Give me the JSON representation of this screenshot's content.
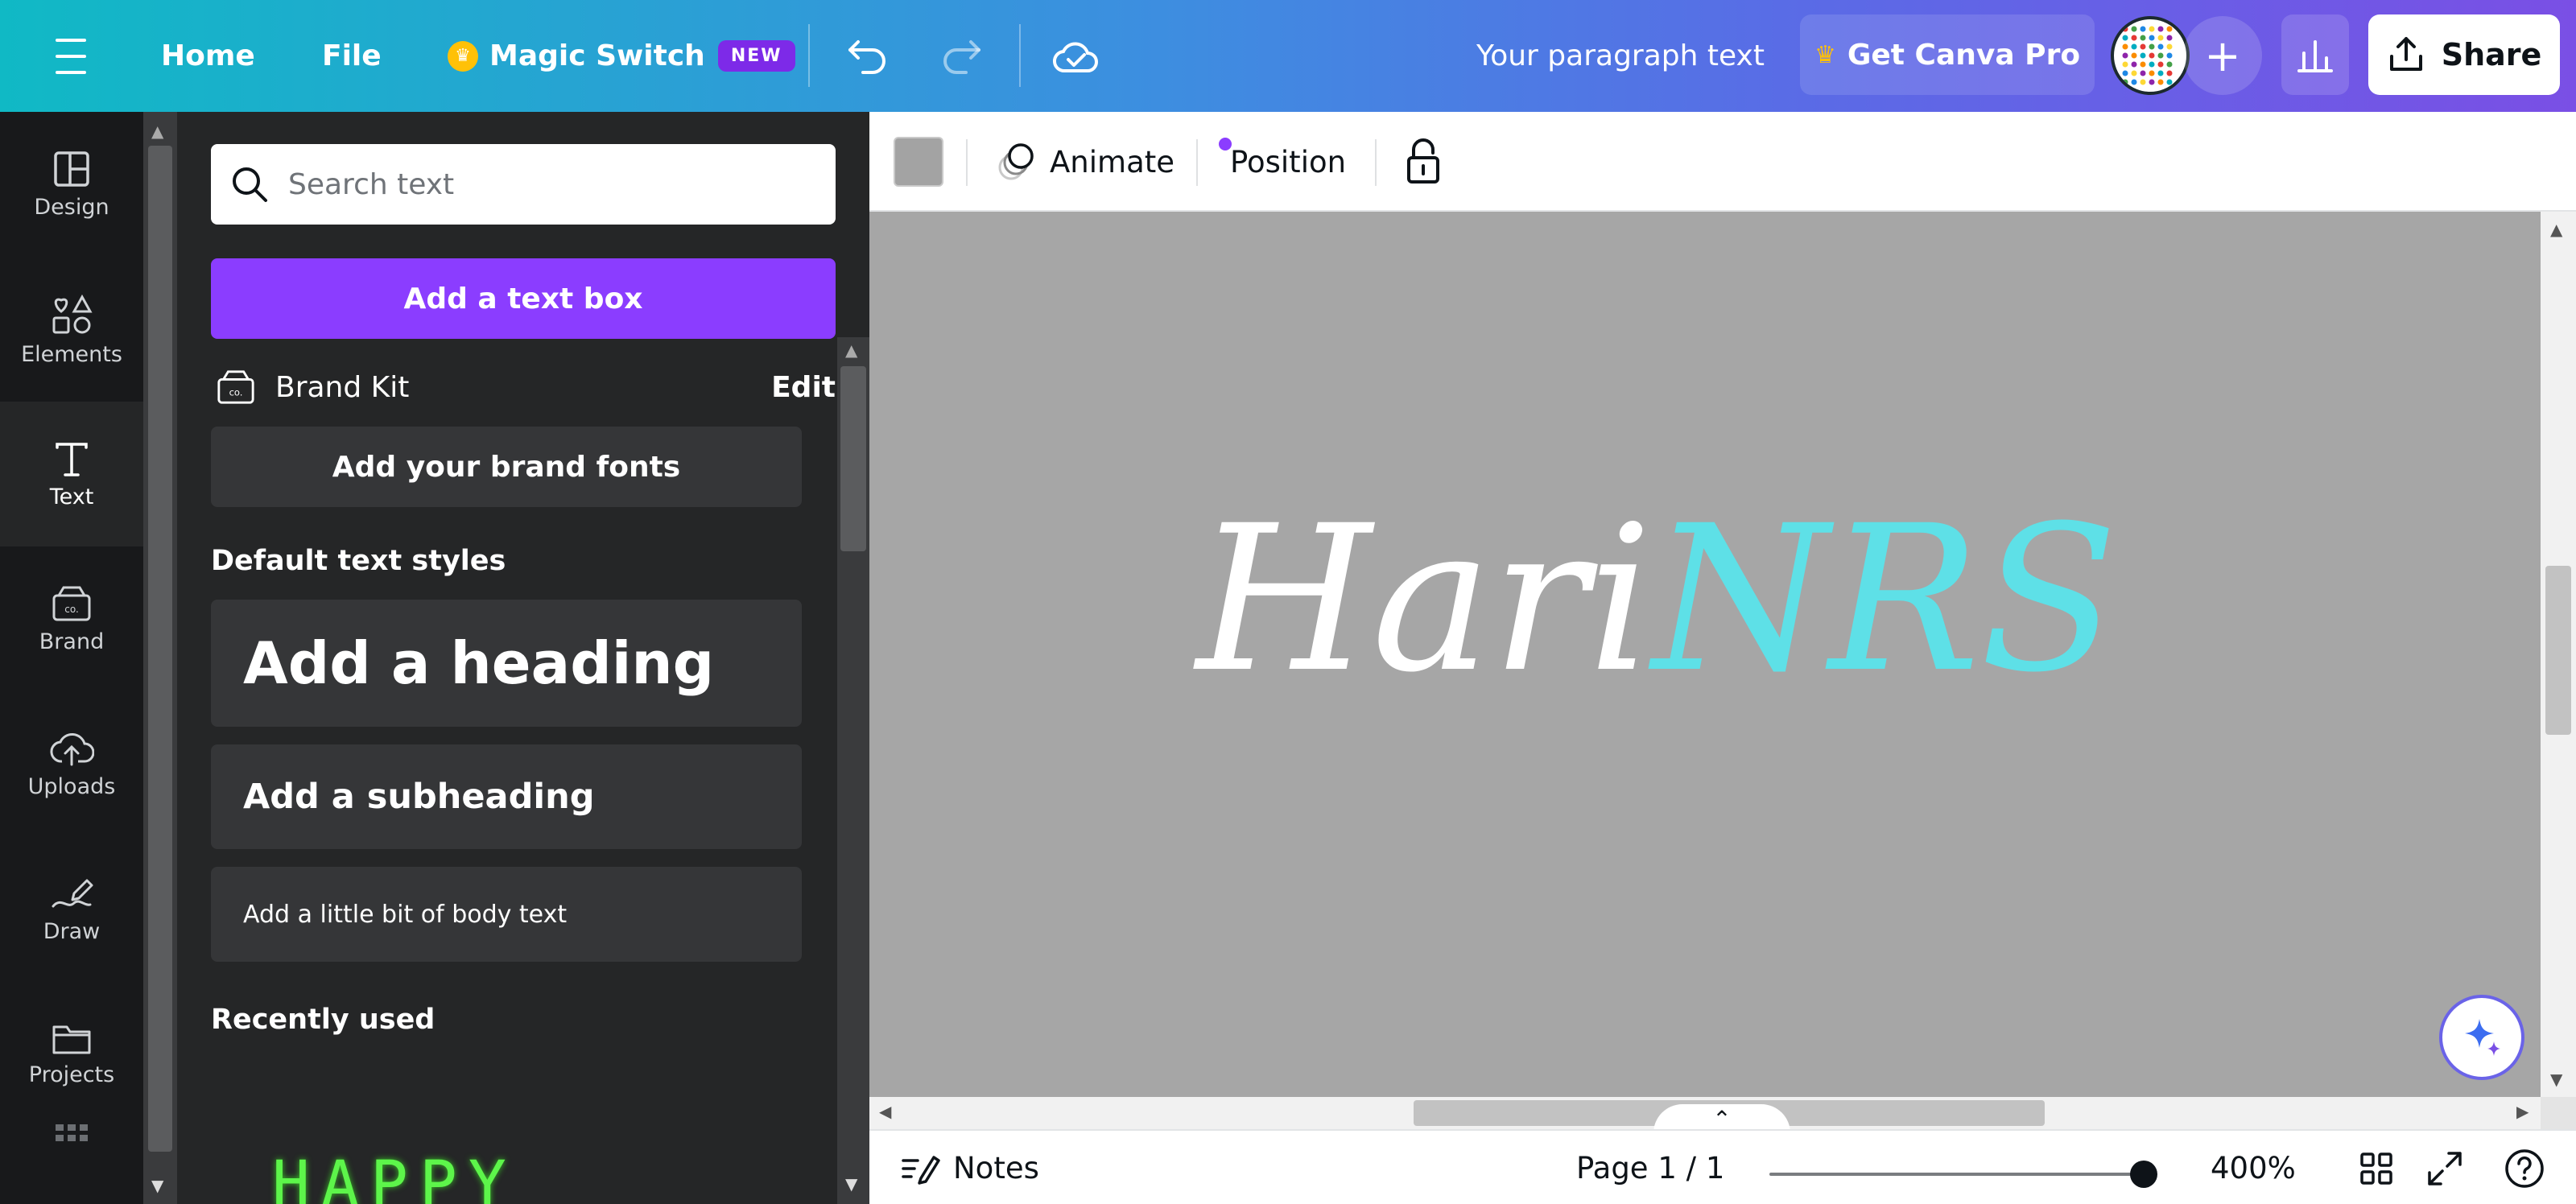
{
  "topbar": {
    "home": "Home",
    "file": "File",
    "magic_switch": "Magic Switch",
    "new_badge": "NEW",
    "doc_title": "Your paragraph text",
    "get_pro": "Get Canva Pro",
    "share": "Share"
  },
  "rail": {
    "items": [
      {
        "label": "Design",
        "icon": "design-icon"
      },
      {
        "label": "Elements",
        "icon": "elements-icon"
      },
      {
        "label": "Text",
        "icon": "text-icon"
      },
      {
        "label": "Brand",
        "icon": "brand-icon"
      },
      {
        "label": "Uploads",
        "icon": "uploads-icon"
      },
      {
        "label": "Draw",
        "icon": "draw-icon"
      },
      {
        "label": "Projects",
        "icon": "projects-icon"
      }
    ]
  },
  "panel": {
    "search_placeholder": "Search text",
    "add_text_box": "Add a text box",
    "brand_kit": "Brand Kit",
    "edit": "Edit",
    "add_brand_fonts": "Add your brand fonts",
    "default_styles_title": "Default text styles",
    "heading": "Add a heading",
    "subheading": "Add a subheading",
    "body": "Add a little bit of body text",
    "recently_used": "Recently used",
    "recent_preview": "HAPPY"
  },
  "toolbar": {
    "swatch_color": "#a3a3a3",
    "animate": "Animate",
    "position": "Position"
  },
  "canvas": {
    "background": "#a6a6a6",
    "text_part1": "Hari",
    "text_part2": "NRS",
    "text_part1_color": "#ffffff",
    "text_part2_color": "#5ee0e7"
  },
  "footer": {
    "notes": "Notes",
    "page": "Page 1 / 1",
    "zoom": "400%"
  },
  "colors": {
    "accent_purple": "#8b3dff"
  }
}
